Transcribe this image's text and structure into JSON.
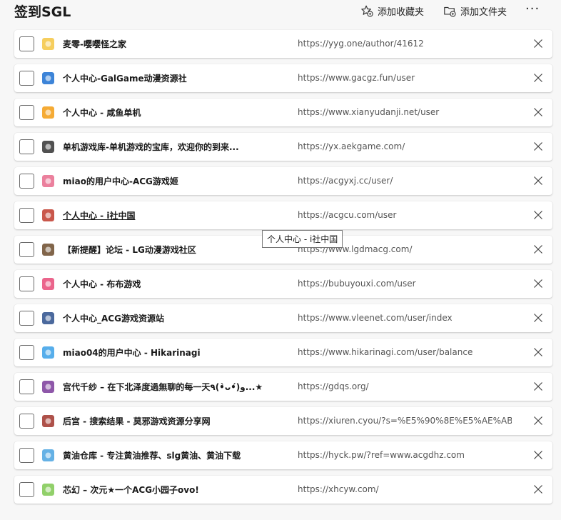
{
  "header": {
    "title": "签到SGL",
    "add_favorite_label": "添加收藏夹",
    "add_folder_label": "添加文件夹",
    "more_label": "···"
  },
  "items": [
    {
      "name": "麦零-嘤嘤怪之家",
      "url": "https://yyg.one/author/41612",
      "icon": "smiley-face-icon",
      "icon_color": "#f5c542"
    },
    {
      "name": "个人中心-GalGame动漫资源社",
      "url": "https://www.gacgz.fun/user",
      "icon": "gacg-logo-icon",
      "icon_color": "#1b6fd1"
    },
    {
      "name": "个人中心 - 咸鱼单机",
      "url": "https://www.xianyudanji.net/user",
      "icon": "xianyu-logo-icon",
      "icon_color": "#f39c12"
    },
    {
      "name": "单机游戏库-单机游戏的宝库，欢迎你的到来...",
      "url": "https://yx.aekgame.com/",
      "icon": "character-icon",
      "icon_color": "#333333"
    },
    {
      "name": "miao的用户中心-ACG游戏姬",
      "url": "https://acgyxj.cc/user/",
      "icon": "anime-girl-icon",
      "icon_color": "#e86a8c"
    },
    {
      "name": "个人中心 - i社中国",
      "url": "https://acgcu.com/user",
      "icon": "isha-logo-icon",
      "icon_color": "#c0392b"
    },
    {
      "name": "【新提醒】论坛 - LG动漫游戏社区",
      "url": "https://www.lgdmacg.com/",
      "icon": "lg-logo-icon",
      "icon_color": "#6b4a2a"
    },
    {
      "name": "个人中心 - 布布游戏",
      "url": "https://bubuyouxi.com/user",
      "icon": "bubu-logo-icon",
      "icon_color": "#e84a78"
    },
    {
      "name": "个人中心_ACG游戏资源站",
      "url": "https://www.vleenet.com/user/index",
      "icon": "vleenet-logo-icon",
      "icon_color": "#2c4f8c"
    },
    {
      "name": "miao04的用户中心 - Hikarinagi",
      "url": "https://www.hikarinagi.com/user/balance",
      "icon": "hikarinagi-logo-icon",
      "icon_color": "#3aa0e8"
    },
    {
      "name": "宫代千纱 – 在下北泽度過無聊的每一天٩(•̀ᴗ•́)و...★",
      "url": "https://gdqs.org/",
      "icon": "gdqs-logo-icon",
      "icon_color": "#7a3a9a"
    },
    {
      "name": "后宫 - 搜索结果 - 莫邪游戏资源分享网",
      "url": "https://xiuren.cyou/?s=%E5%90%8E%E5%AE%AB",
      "icon": "moye-logo-icon",
      "icon_color": "#a0322a"
    },
    {
      "name": "黄油仓库 - 专注黄油推荐、slg黄油、黄油下载",
      "url": "https://hyck.pw/?ref=www.acgdhz.com",
      "icon": "heart-butterfly-icon",
      "icon_color": "#4aa3e0"
    },
    {
      "name": "芯幻 – 次元★一个ACG小园子ovo!",
      "url": "https://xhcyw.com/",
      "icon": "xinhuan-logo-icon",
      "icon_color": "#7ec850"
    }
  ],
  "tooltip": "个人中心 - i社中国",
  "hovered_index": 5
}
